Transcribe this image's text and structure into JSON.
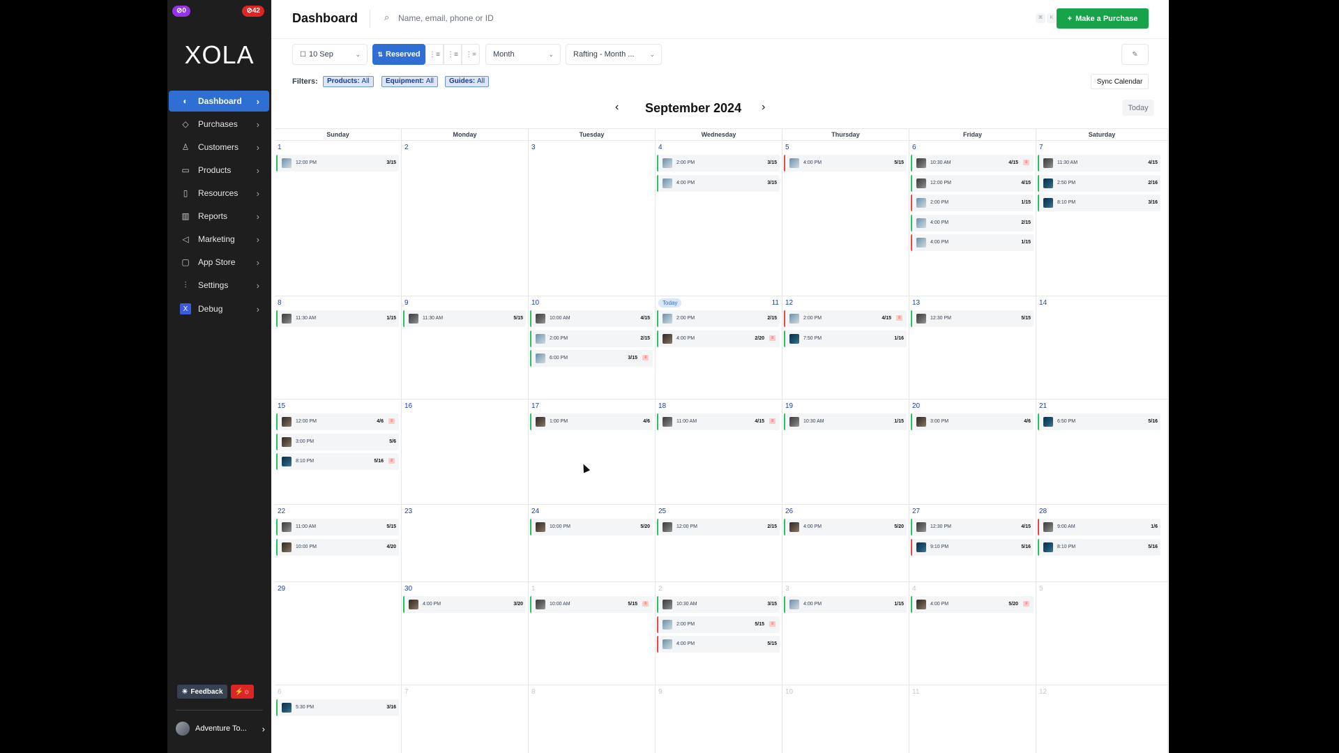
{
  "sidebar": {
    "badge_left": "⊘0",
    "badge_right": "⊘42",
    "logo": "XOLA",
    "items": [
      {
        "label": "Dashboard",
        "icon": "dashboard-icon",
        "glyph": "◐",
        "active": true
      },
      {
        "label": "Purchases",
        "icon": "tag-icon",
        "glyph": "◇"
      },
      {
        "label": "Customers",
        "icon": "users-icon",
        "glyph": "♙"
      },
      {
        "label": "Products",
        "icon": "box-icon",
        "glyph": "▭"
      },
      {
        "label": "Resources",
        "icon": "clipboard-icon",
        "glyph": "▯"
      },
      {
        "label": "Reports",
        "icon": "bar-chart-icon",
        "glyph": "▥"
      },
      {
        "label": "Marketing",
        "icon": "megaphone-icon",
        "glyph": "◁"
      },
      {
        "label": "App Store",
        "icon": "store-icon",
        "glyph": "▢"
      },
      {
        "label": "Settings",
        "icon": "sliders-icon",
        "glyph": "⫶"
      },
      {
        "label": "Debug",
        "icon": "debug-icon",
        "glyph": "X"
      }
    ],
    "feedback_label": "Feedback",
    "account_label": "Adventure To..."
  },
  "header": {
    "title": "Dashboard",
    "search_placeholder": "Name, email, phone or ID",
    "kbd1": "⌘",
    "kbd2": "K",
    "purchase_label": "Make a Purchase"
  },
  "toolbar": {
    "date_label": "10 Sep",
    "reserved_label": "Reserved",
    "seg1": "⋮≡",
    "seg2": "⋮≡",
    "seg3": "⋮=",
    "view_label": "Month",
    "product_label": "Rafting - Month ...",
    "wand": "✎"
  },
  "filters": {
    "label": "Filters:",
    "products_key": "Products:",
    "products_val": "All",
    "equipment_key": "Equipment:",
    "equipment_val": "All",
    "guides_key": "Guides:",
    "guides_val": "All",
    "sync_label": "Sync Calendar"
  },
  "calendar": {
    "month_title": "September 2024",
    "today_btn": "Today",
    "today_pill": "Today",
    "days": [
      "Sunday",
      "Monday",
      "Tuesday",
      "Wednesday",
      "Thursday",
      "Friday",
      "Saturday"
    ],
    "weeks": [
      [
        {
          "d": "1",
          "ev": [
            {
              "t": "12:00 PM",
              "c": "3/15",
              "th": "a",
              "col": "g"
            }
          ]
        },
        {
          "d": "2",
          "ev": []
        },
        {
          "d": "3",
          "ev": []
        },
        {
          "d": "4",
          "ev": [
            {
              "t": "2:00 PM",
              "c": "3/15",
              "th": "a",
              "col": "g"
            },
            {
              "t": "4:00 PM",
              "c": "3/15",
              "th": "a",
              "col": "g"
            }
          ]
        },
        {
          "d": "5",
          "ev": [
            {
              "t": "4:00 PM",
              "c": "5/15",
              "th": "a",
              "col": "r"
            }
          ]
        },
        {
          "d": "6",
          "ev": [
            {
              "t": "10:30 AM",
              "c": "4/15",
              "th": "b",
              "col": "g",
              "flag": true
            },
            {
              "t": "12:00 PM",
              "c": "4/15",
              "th": "b",
              "col": "g"
            },
            {
              "t": "2:00 PM",
              "c": "1/15",
              "th": "a",
              "col": "r"
            },
            {
              "t": "4:00 PM",
              "c": "2/15",
              "th": "a",
              "col": "g"
            },
            {
              "t": "4:00 PM",
              "c": "1/15",
              "th": "a",
              "col": "r"
            }
          ]
        },
        {
          "d": "7",
          "ev": [
            {
              "t": "11:30 AM",
              "c": "4/15",
              "th": "b",
              "col": "g"
            },
            {
              "t": "2:50 PM",
              "c": "2/16",
              "th": "c",
              "col": "g"
            },
            {
              "t": "8:10 PM",
              "c": "3/16",
              "th": "c",
              "col": "g"
            }
          ]
        }
      ],
      [
        {
          "d": "8",
          "ev": [
            {
              "t": "11:30 AM",
              "c": "1/15",
              "th": "b",
              "col": "g"
            }
          ]
        },
        {
          "d": "9",
          "ev": [
            {
              "t": "11:30 AM",
              "c": "5/15",
              "th": "b",
              "col": "g"
            }
          ]
        },
        {
          "d": "10",
          "ev": [
            {
              "t": "10:00 AM",
              "c": "4/15",
              "th": "b",
              "col": "g"
            },
            {
              "t": "2:00 PM",
              "c": "2/15",
              "th": "a",
              "col": "g"
            },
            {
              "t": "6:00 PM",
              "c": "3/15",
              "th": "a",
              "col": "g",
              "flag": true
            }
          ]
        },
        {
          "d": "11",
          "today": true,
          "ev": [
            {
              "t": "2:00 PM",
              "c": "2/15",
              "th": "a",
              "col": "g"
            },
            {
              "t": "4:00 PM",
              "c": "2/20",
              "th": "d",
              "col": "g",
              "flag": true
            }
          ]
        },
        {
          "d": "12",
          "ev": [
            {
              "t": "2:00 PM",
              "c": "4/15",
              "th": "a",
              "col": "r",
              "flag": true
            },
            {
              "t": "7:50 PM",
              "c": "1/16",
              "th": "c",
              "col": "g"
            }
          ]
        },
        {
          "d": "13",
          "ev": [
            {
              "t": "12:30 PM",
              "c": "5/15",
              "th": "b",
              "col": "g"
            }
          ]
        },
        {
          "d": "14",
          "ev": []
        }
      ],
      [
        {
          "d": "15",
          "ev": [
            {
              "t": "12:00 PM",
              "c": "4/6",
              "th": "d",
              "col": "g",
              "flag": true
            },
            {
              "t": "3:00 PM",
              "c": "5/6",
              "th": "d",
              "col": "g"
            },
            {
              "t": "8:10 PM",
              "c": "5/16",
              "th": "c",
              "col": "g",
              "flag": true
            }
          ]
        },
        {
          "d": "16",
          "ev": []
        },
        {
          "d": "17",
          "ev": [
            {
              "t": "1:00 PM",
              "c": "4/6",
              "th": "d",
              "col": "g"
            }
          ]
        },
        {
          "d": "18",
          "ev": [
            {
              "t": "11:00 AM",
              "c": "4/15",
              "th": "b",
              "col": "g",
              "flag": true
            }
          ]
        },
        {
          "d": "19",
          "ev": [
            {
              "t": "10:30 AM",
              "c": "1/15",
              "th": "b",
              "col": "g"
            }
          ]
        },
        {
          "d": "20",
          "ev": [
            {
              "t": "3:00 PM",
              "c": "4/6",
              "th": "d",
              "col": "g"
            }
          ]
        },
        {
          "d": "21",
          "ev": [
            {
              "t": "6:50 PM",
              "c": "5/16",
              "th": "c",
              "col": "g"
            }
          ]
        }
      ],
      [
        {
          "d": "22",
          "ev": [
            {
              "t": "11:00 AM",
              "c": "5/15",
              "th": "b",
              "col": "g"
            },
            {
              "t": "10:00 PM",
              "c": "4/20",
              "th": "d",
              "col": "g"
            }
          ]
        },
        {
          "d": "23",
          "ev": []
        },
        {
          "d": "24",
          "ev": [
            {
              "t": "10:00 PM",
              "c": "5/20",
              "th": "d",
              "col": "g"
            }
          ]
        },
        {
          "d": "25",
          "ev": [
            {
              "t": "12:00 PM",
              "c": "2/15",
              "th": "b",
              "col": "g"
            }
          ]
        },
        {
          "d": "26",
          "ev": [
            {
              "t": "4:00 PM",
              "c": "5/20",
              "th": "d",
              "col": "g"
            }
          ]
        },
        {
          "d": "27",
          "ev": [
            {
              "t": "12:30 PM",
              "c": "4/15",
              "th": "b",
              "col": "g"
            },
            {
              "t": "9:10 PM",
              "c": "5/16",
              "th": "c",
              "col": "r"
            }
          ]
        },
        {
          "d": "28",
          "ev": [
            {
              "t": "9:00 AM",
              "c": "1/6",
              "th": "b",
              "col": "r"
            },
            {
              "t": "8:10 PM",
              "c": "5/16",
              "th": "c",
              "col": "g"
            }
          ]
        }
      ],
      [
        {
          "d": "29",
          "ev": []
        },
        {
          "d": "30",
          "ev": [
            {
              "t": "4:00 PM",
              "c": "3/20",
              "th": "d",
              "col": "g"
            }
          ]
        },
        {
          "d": "1",
          "other": true,
          "ev": [
            {
              "t": "10:00 AM",
              "c": "5/15",
              "th": "b",
              "col": "g",
              "flag": true
            }
          ]
        },
        {
          "d": "2",
          "other": true,
          "ev": [
            {
              "t": "10:30 AM",
              "c": "3/15",
              "th": "b",
              "col": "g"
            },
            {
              "t": "2:00 PM",
              "c": "5/15",
              "th": "a",
              "col": "r",
              "flag": true
            },
            {
              "t": "4:00 PM",
              "c": "5/15",
              "th": "a",
              "col": "r"
            }
          ]
        },
        {
          "d": "3",
          "other": true,
          "ev": [
            {
              "t": "4:00 PM",
              "c": "1/15",
              "th": "a",
              "col": "g"
            }
          ]
        },
        {
          "d": "4",
          "other": true,
          "ev": [
            {
              "t": "4:00 PM",
              "c": "5/20",
              "th": "d",
              "col": "g",
              "flag": true
            }
          ]
        },
        {
          "d": "5",
          "other": true,
          "ev": []
        }
      ],
      [
        {
          "d": "6",
          "other": true,
          "ev": [
            {
              "t": "5:30 PM",
              "c": "3/16",
              "th": "c",
              "col": "g"
            }
          ]
        },
        {
          "d": "7",
          "other": true,
          "ev": []
        },
        {
          "d": "8",
          "other": true,
          "ev": []
        },
        {
          "d": "9",
          "other": true,
          "ev": []
        },
        {
          "d": "10",
          "other": true,
          "ev": []
        },
        {
          "d": "11",
          "other": true,
          "ev": []
        },
        {
          "d": "12",
          "other": true,
          "ev": []
        }
      ]
    ]
  }
}
